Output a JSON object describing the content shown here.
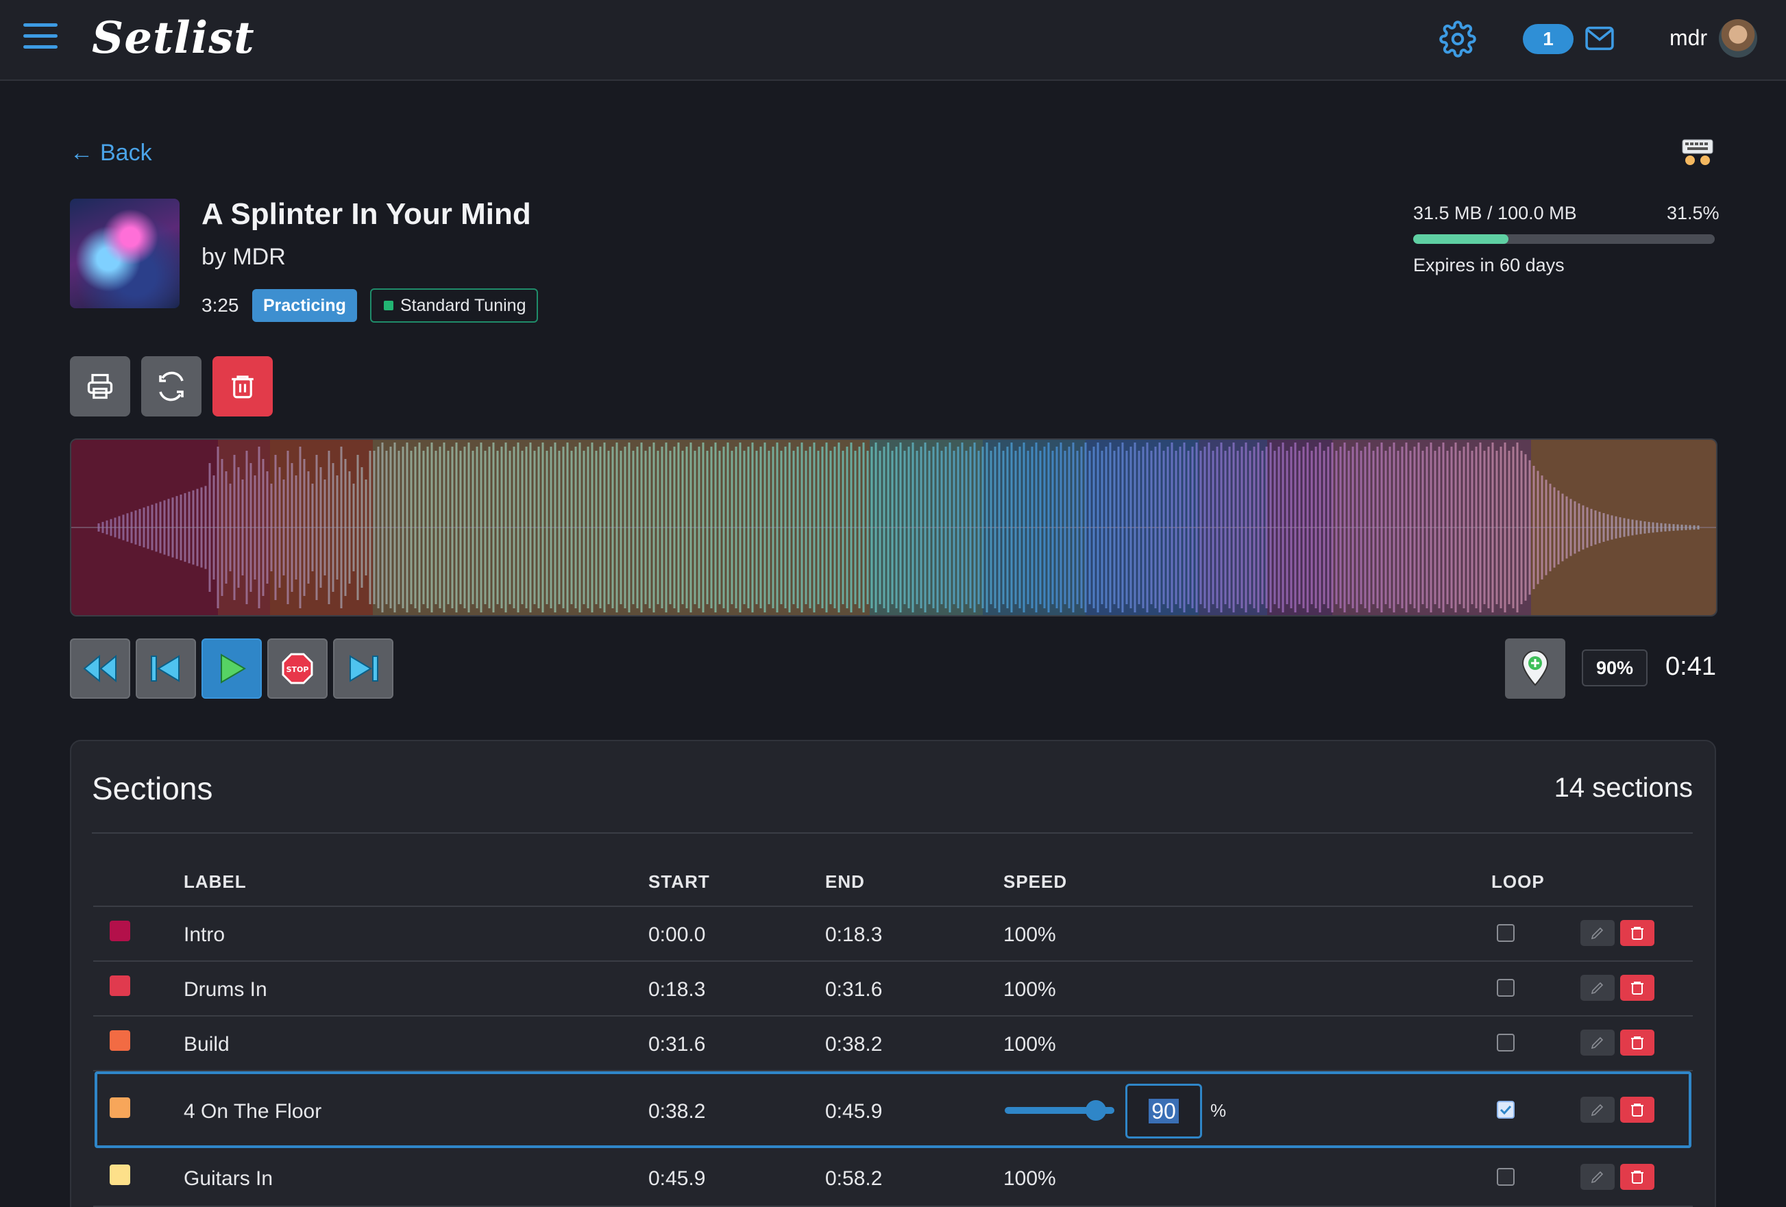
{
  "nav": {
    "brand": "Setlist",
    "message_count": "1",
    "username": "mdr"
  },
  "page": {
    "back_label": "Back",
    "song_title": "A Splinter In Your Mind",
    "artist": "by MDR",
    "duration": "3:25",
    "status": "Practicing",
    "tuning": "Standard Tuning",
    "storage_used": "31.5 MB / 100.0 MB",
    "storage_percent_label": "31.5%",
    "storage_fraction": 0.315,
    "expires": "Expires in 60 days"
  },
  "transport": {
    "playback_speed": "90%",
    "current_time": "0:41"
  },
  "sections": {
    "title": "Sections",
    "count_label": "14 sections",
    "columns": [
      "LABEL",
      "START",
      "END",
      "SPEED",
      "LOOP"
    ],
    "rows": [
      {
        "color": "#b3104a",
        "label": "Intro",
        "start": "0:00.0",
        "end": "0:18.3",
        "speed": "100%",
        "loop": false
      },
      {
        "color": "#e03a4e",
        "label": "Drums In",
        "start": "0:18.3",
        "end": "0:31.6",
        "speed": "100%",
        "loop": false
      },
      {
        "color": "#f26b43",
        "label": "Build",
        "start": "0:31.6",
        "end": "0:38.2",
        "speed": "100%",
        "loop": false
      },
      {
        "color": "#f7a65a",
        "label": "4 On The Floor",
        "start": "0:38.2",
        "end": "0:45.9",
        "speed_value": "90",
        "speed_unit": "%",
        "loop": true
      },
      {
        "color": "#fde08a",
        "label": "Guitars In",
        "start": "0:45.9",
        "end": "0:58.2",
        "speed": "100%",
        "loop": false
      }
    ]
  },
  "colors": {
    "accent": "#2f86c8",
    "danger": "#e23b4a",
    "storage_bar": "#5fd0a3"
  },
  "icons": [
    "menu-icon",
    "gear-icon",
    "mail-icon",
    "keyboard-icon",
    "print-icon",
    "sync-icon",
    "trash-icon",
    "rewind-icon",
    "skip-back-icon",
    "play-icon",
    "stop-icon",
    "skip-forward-icon",
    "add-marker-icon",
    "pencil-icon"
  ]
}
